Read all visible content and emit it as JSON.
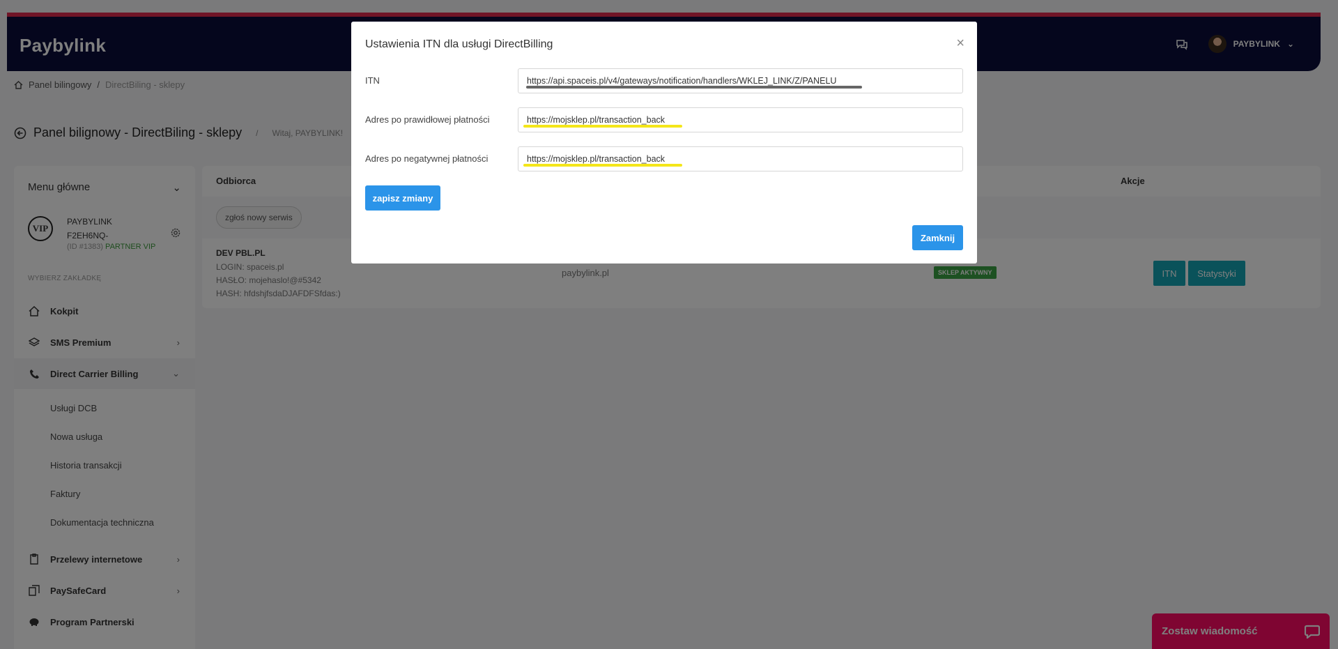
{
  "header": {
    "logo": "Paybylink",
    "user_name": "PAYBYLINK"
  },
  "breadcrumb": {
    "items": [
      "Panel bilingowy",
      "/",
      "DirectBiling - sklepy"
    ]
  },
  "page": {
    "title": "Panel bilignowy - DirectBiling - sklepy",
    "separator": "/",
    "welcome": "Witaj, PAYBYLINK!"
  },
  "sidebar": {
    "menu_title": "Menu główne",
    "profile": {
      "badge": "VIP",
      "name_line1": "PAYBYLINK",
      "name_line2": "F2EH6NQ-",
      "id": "(ID #1383)",
      "partner": "PARTNER VIP"
    },
    "choose_label": "WYBIERZ ZAKŁADKĘ",
    "items": [
      {
        "label": "Kokpit",
        "icon": "home-icon"
      },
      {
        "label": "SMS Premium",
        "icon": "layers-icon"
      },
      {
        "label": "Direct Carrier Billing",
        "icon": "phone-icon"
      },
      {
        "label": "Przelewy internetowe",
        "icon": "document-icon"
      },
      {
        "label": "PaySafeCard",
        "icon": "cards-icon"
      },
      {
        "label": "Program Partnerski",
        "icon": "piggy-bank-icon"
      }
    ],
    "dcb_sub": [
      "Usługi DCB",
      "Nowa usługa",
      "Historia transakcji",
      "Faktury",
      "Dokumentacja techniczna"
    ]
  },
  "table": {
    "headers": {
      "recipient": "Odbiorca",
      "actions": "Akcje"
    },
    "new_service": "zgłoś nowy serwis",
    "row": {
      "name": "DEV PBL.PL",
      "login": "LOGIN: spaceis.pl",
      "password": "HASŁO: mojehaslo!@#5342",
      "hash": "HASH: hfdshjfsdaDJAFDFSfdas:)",
      "domain": "paybylink.pl",
      "status": "SKLEP AKTYWNY",
      "btn_itn": "ITN",
      "btn_stats": "Statystyki"
    }
  },
  "modal": {
    "title": "Ustawienia ITN dla usługi DirectBilling",
    "close_symbol": "×",
    "fields": [
      {
        "label": "ITN",
        "value": "https://api.spaceis.pl/v4/gateways/notification/handlers/WKLEJ_LINK/Z/PANELU"
      },
      {
        "label": "Adres po prawidłowej płatności",
        "value": "https://mojsklep.pl/transaction_back"
      },
      {
        "label": "Adres po negatywnej płatności",
        "value": "https://mojsklep.pl/transaction_back"
      }
    ],
    "save_label": "zapisz zmiany",
    "close_label": "Zamknij"
  },
  "chat_widget": {
    "label": "Zostaw wiadomość"
  },
  "colors": {
    "header_bg": "#0a0c3a",
    "header_accent": "#e0284e",
    "primary": "#2b94e9",
    "teal": "#15a4b5",
    "success": "#3aa244",
    "chat": "#ff0a64"
  }
}
